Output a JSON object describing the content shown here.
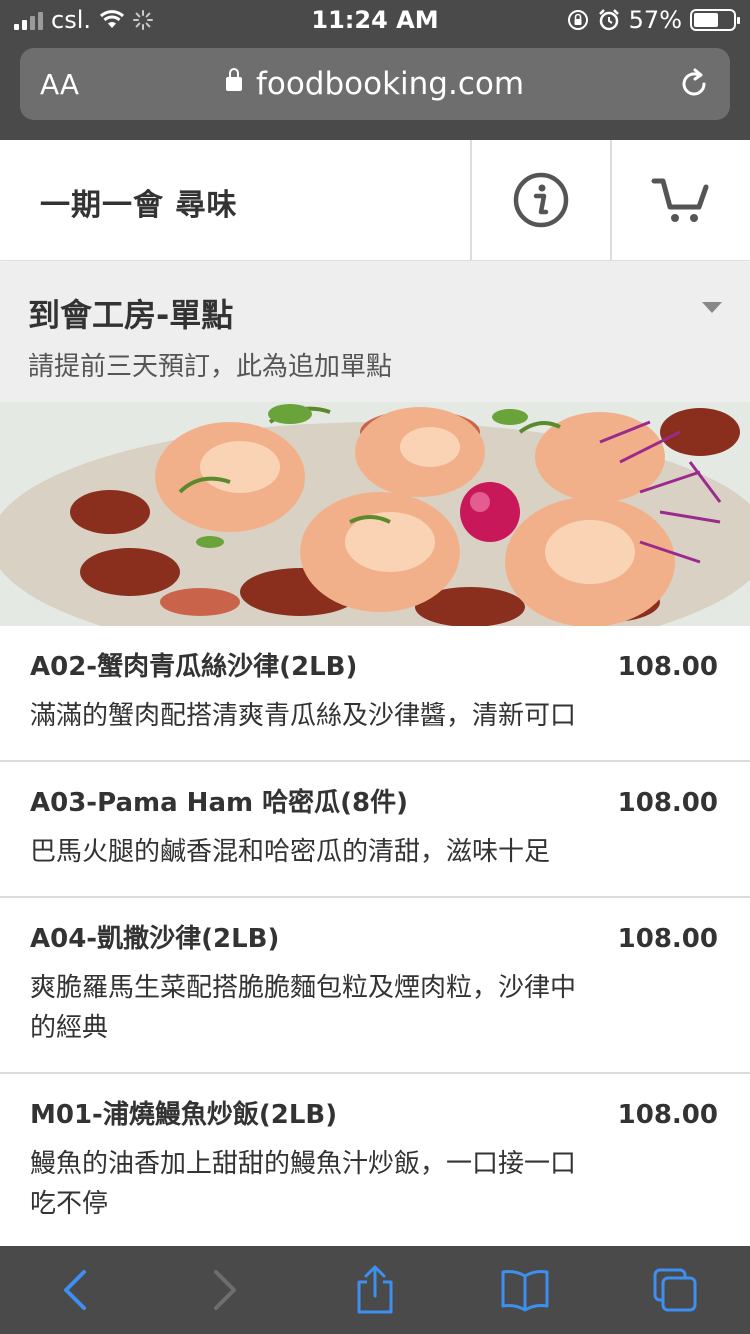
{
  "status": {
    "carrier": "csl.",
    "time": "11:24 AM",
    "battery_text": "57%"
  },
  "browser": {
    "text_size_label": "AA",
    "domain": "foodbooking.com"
  },
  "header": {
    "title": "一期一會 尋味"
  },
  "category": {
    "title": "到會工房-單點",
    "subtitle": "請提前三天預訂，此為追加單點"
  },
  "menu": [
    {
      "name": "A02-蟹肉青瓜絲沙律(2LB)",
      "desc": "滿滿的蟹肉配搭清爽青瓜絲及沙律醬，清新可口",
      "price": "108.00"
    },
    {
      "name": "A03-Pama Ham 哈密瓜(8件)",
      "desc": "巴馬火腿的鹹香混和哈密瓜的清甜，滋味十足",
      "price": "108.00"
    },
    {
      "name": "A04-凱撒沙律(2LB)",
      "desc": "爽脆羅馬生菜配搭脆脆麵包粒及煙肉粒，沙律中的經典",
      "price": "108.00"
    },
    {
      "name": "M01-浦燒鰻魚炒飯(2LB)",
      "desc": "鰻魚的油香加上甜甜的鰻魚汁炒飯，一口接一口吃不停",
      "price": "108.00"
    }
  ],
  "colors": {
    "toolbar_bg": "#4a4a4a",
    "accent_blue": "#3d8ff0"
  }
}
